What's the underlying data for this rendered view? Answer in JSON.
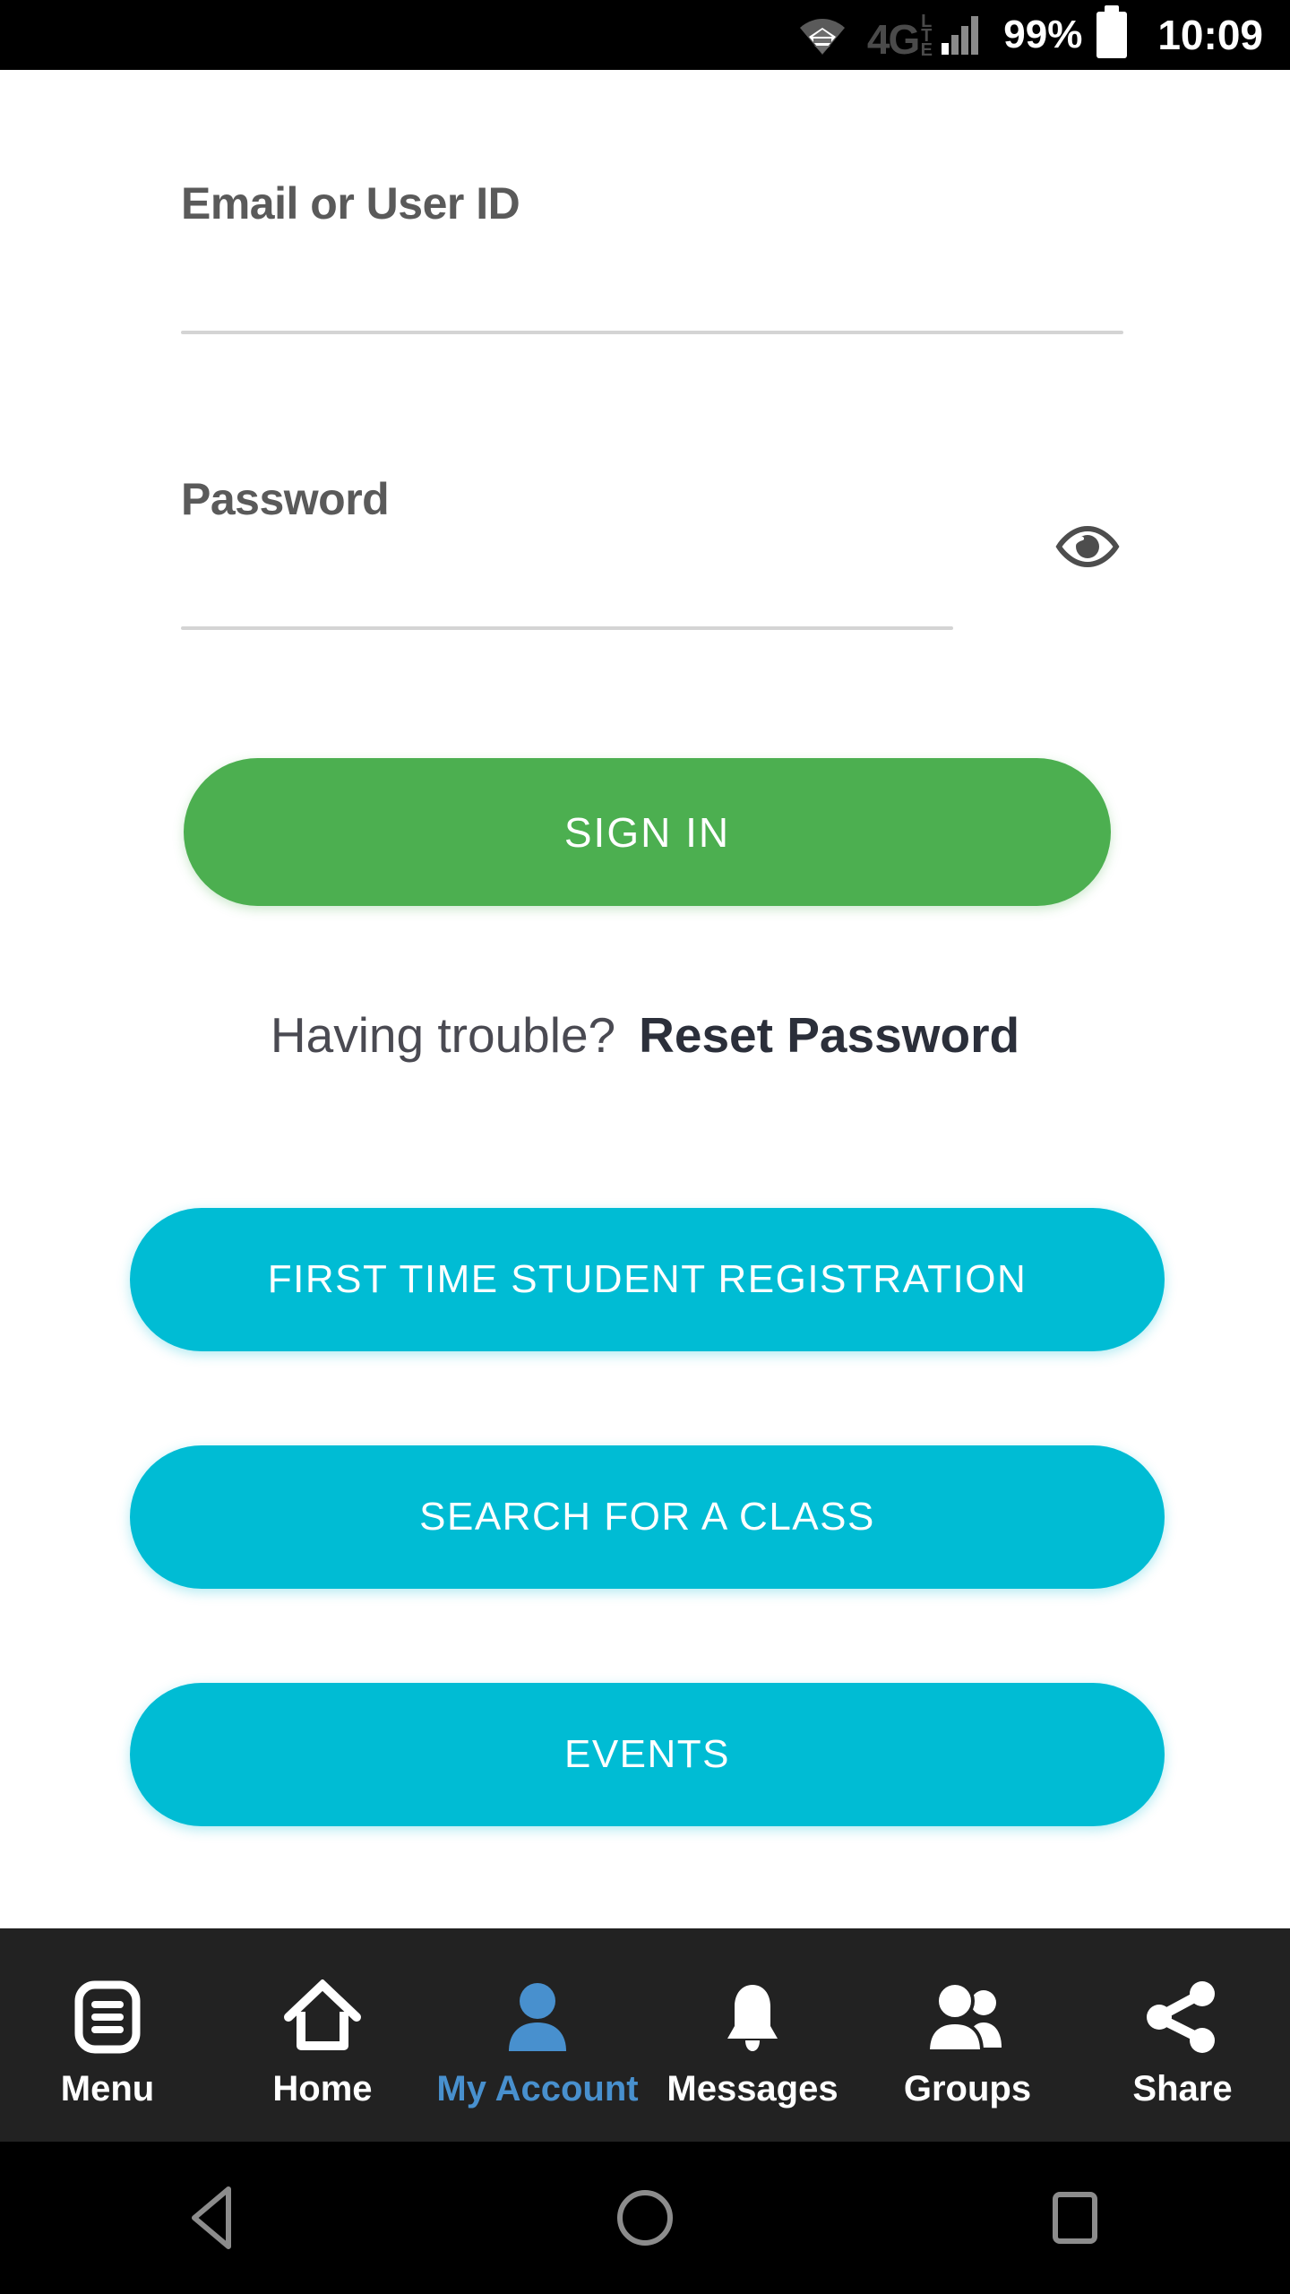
{
  "status_bar": {
    "wifi_icon": "wifi-icon",
    "network_type": "4G",
    "network_suffix": "LTE",
    "signal_icon": "signal-bars-icon",
    "battery_percent": "99%",
    "battery_icon": "battery-full-icon",
    "clock": "10:09"
  },
  "form": {
    "email": {
      "label": "Email or User ID",
      "value": "",
      "placeholder": ""
    },
    "password": {
      "label": "Password",
      "value": "",
      "placeholder": "",
      "toggle_icon": "eye-icon"
    },
    "sign_in_label": "SIGN IN"
  },
  "help": {
    "trouble_text": "Having trouble?",
    "reset_link": "Reset Password"
  },
  "actions": [
    {
      "label": "FIRST TIME STUDENT REGISTRATION",
      "name": "first-time-student-registration"
    },
    {
      "label": "SEARCH FOR A CLASS",
      "name": "search-for-a-class"
    },
    {
      "label": "EVENTS",
      "name": "events"
    }
  ],
  "bottom_nav": [
    {
      "label": "Menu",
      "icon": "menu-icon",
      "active": false
    },
    {
      "label": "Home",
      "icon": "home-icon",
      "active": false
    },
    {
      "label": "My Account",
      "icon": "person-icon",
      "active": true
    },
    {
      "label": "Messages",
      "icon": "bell-icon",
      "active": false
    },
    {
      "label": "Groups",
      "icon": "people-icon",
      "active": false
    },
    {
      "label": "Share",
      "icon": "share-icon",
      "active": false
    }
  ],
  "system_bar": {
    "back": "back-triangle-icon",
    "home": "home-circle-icon",
    "recents": "recents-square-icon"
  },
  "colors": {
    "primary_green": "#4CAF50",
    "primary_cyan": "#00BCD4",
    "active_nav_blue": "#4890CE",
    "nav_background": "#222222",
    "label_gray": "#5a5a5a",
    "underline_gray": "#d4d4d4"
  }
}
